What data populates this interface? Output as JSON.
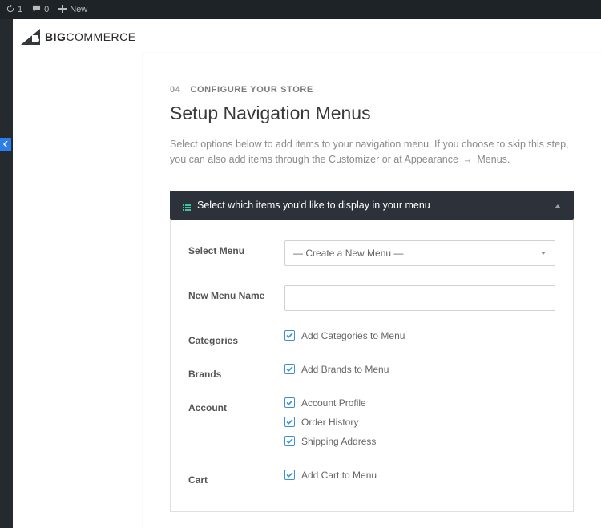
{
  "adminbar": {
    "refresh_count": "1",
    "comments_count": "0",
    "new_label": "New"
  },
  "logo": {
    "prefix": "BIG",
    "suffix": "COMMERCE"
  },
  "step": {
    "number": "04",
    "eyebrow": "CONFIGURE YOUR STORE"
  },
  "title": "Setup Navigation Menus",
  "description_prefix": "Select options below to add items to your navigation menu. If you choose to skip this step, you can also add items through the Customizer or at Appearance ",
  "description_suffix": " Menus.",
  "accordion": {
    "header": "Select which items you'd like to display in your menu"
  },
  "fields": {
    "select_menu": {
      "label": "Select Menu",
      "value": "— Create a New Menu —"
    },
    "new_menu_name": {
      "label": "New Menu Name",
      "placeholder": ""
    },
    "categories": {
      "label": "Categories",
      "items": [
        {
          "label": "Add Categories to Menu",
          "checked": true
        }
      ]
    },
    "brands": {
      "label": "Brands",
      "items": [
        {
          "label": "Add Brands to Menu",
          "checked": true
        }
      ]
    },
    "account": {
      "label": "Account",
      "items": [
        {
          "label": "Account Profile",
          "checked": true
        },
        {
          "label": "Order History",
          "checked": true
        },
        {
          "label": "Shipping Address",
          "checked": true
        }
      ]
    },
    "cart": {
      "label": "Cart",
      "items": [
        {
          "label": "Add Cart to Menu",
          "checked": true
        }
      ]
    }
  }
}
